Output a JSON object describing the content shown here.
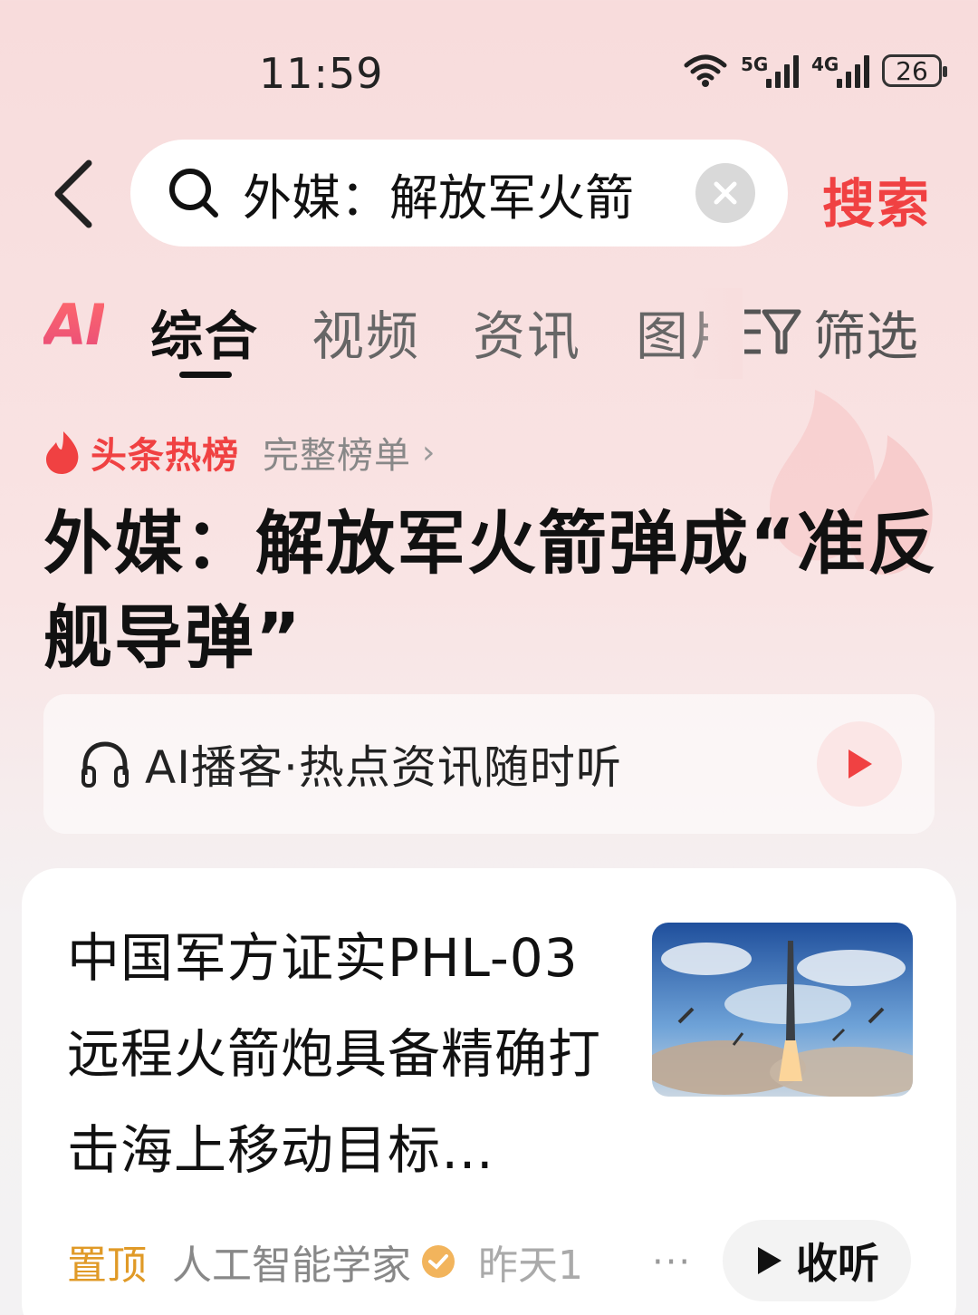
{
  "status_bar": {
    "time": "11:59",
    "net1": "5G",
    "net2": "4G",
    "battery": "26"
  },
  "search": {
    "query": "外媒：解放军火箭",
    "button_label": "搜索"
  },
  "tabs": {
    "ai_label": "AI",
    "items": [
      {
        "label": "综合"
      },
      {
        "label": "视频"
      },
      {
        "label": "资讯"
      },
      {
        "label": "图片"
      }
    ],
    "filter_label": "筛选"
  },
  "hot": {
    "tag": "头条热榜",
    "full_list": "完整榜单",
    "headline": "外媒：解放军火箭弹成“准反舰导弹”"
  },
  "podcast": {
    "label": "AI播客·热点资讯随时听"
  },
  "article": {
    "title": "中国军方证实PHL-03远程火箭炮具备精确打击海上移动目标…",
    "pinned": "置顶",
    "author": "人工智能学家",
    "time": "昨天1",
    "more": "···",
    "listen_label": "收听"
  },
  "colors": {
    "accent": "#f04142",
    "pin": "#e09a27"
  }
}
